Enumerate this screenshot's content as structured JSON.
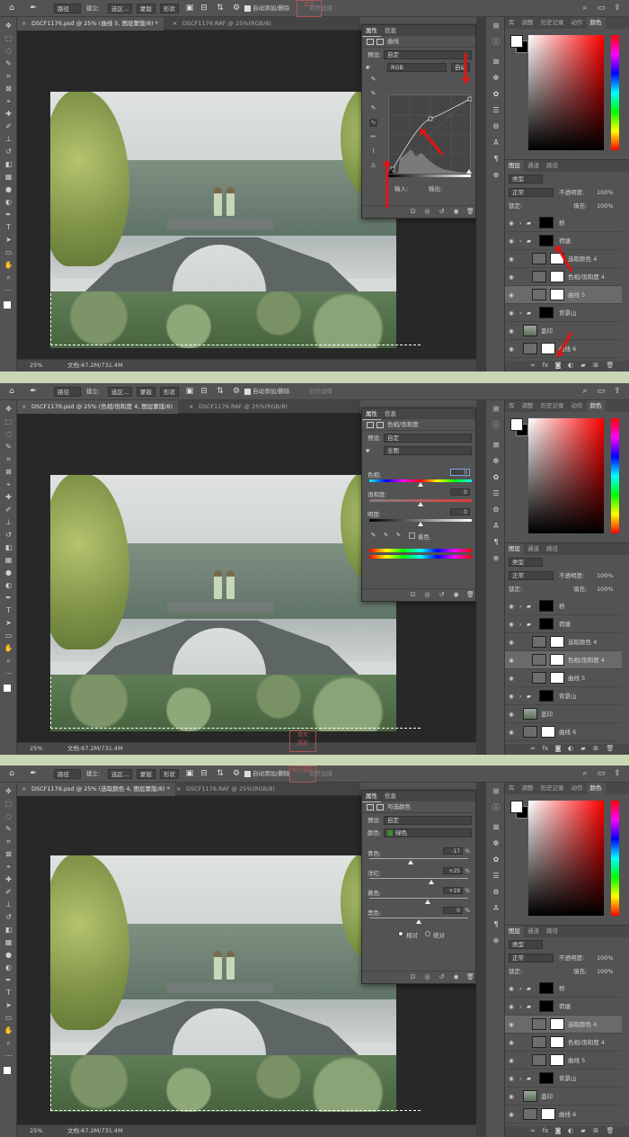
{
  "toolbar": {
    "path_label": "路径",
    "build_label": "建立:",
    "selection_btn": "选区...",
    "mask_btn": "蒙版",
    "shape_btn": "形状",
    "auto_add": "自动添加/删除",
    "align_edges": "对齐边缘"
  },
  "screens": [
    {
      "tab_active": "DSCF1176.psd @ 25% (曲线 5, 图层蒙版/8) *",
      "tab_other": "DSCF1176.RAF @ 25%(RGB/8)",
      "status": {
        "zoom": "25%",
        "doc": "文档:67.2M/731.4M"
      },
      "panel_tabs": [
        "属性",
        "信息"
      ],
      "panel_title": "曲线",
      "preset_label": "预设:",
      "preset_value": "自定",
      "channel_value": "RGB",
      "auto_btn": "自动",
      "input_label": "输入:",
      "output_label": "输出:",
      "selected_layer_index": 4
    },
    {
      "tab_active": "DSCF1176.psd @ 25% (色相/饱和度 4, 图层蒙版/8)",
      "tab_other": "DSCF1176.RAF @ 25%(RGB/8)",
      "status": {
        "zoom": "25%",
        "doc": "文档:67.2M/731.4M"
      },
      "panel_tabs": [
        "属性",
        "信息"
      ],
      "panel_title": "色相/饱和度",
      "preset_label": "预设:",
      "preset_value": "自定",
      "range_value": "全图",
      "hue_label": "色相:",
      "hue_value": "0",
      "sat_label": "饱和度:",
      "sat_value": "0",
      "light_label": "明度:",
      "light_value": "0",
      "colorize_label": "着色",
      "selected_layer_index": 3
    },
    {
      "tab_active": "DSCF1176.psd @ 25% (选取颜色 4, 图层蒙版/8) *",
      "tab_other": "DSCF1176.RAF @ 25%(RGB/8)",
      "status": {
        "zoom": "25%",
        "doc": "文档:67.2M/731.4M"
      },
      "panel_tabs": [
        "属性",
        "信息"
      ],
      "panel_title": "可选颜色",
      "preset_label": "预设:",
      "preset_value": "自定",
      "color_label": "颜色:",
      "color_value": "绿色",
      "sliders": [
        {
          "label": "青色:",
          "value": "-17",
          "unit": "%",
          "pos": 0.415
        },
        {
          "label": "洋红:",
          "value": "+25",
          "unit": "%",
          "pos": 0.625
        },
        {
          "label": "黄色:",
          "value": "+19",
          "unit": "%",
          "pos": 0.595
        },
        {
          "label": "黑色:",
          "value": "0",
          "unit": "%",
          "pos": 0.5
        }
      ],
      "mode_relative": "相对",
      "mode_absolute": "绝对",
      "selected_layer_index": 2
    }
  ],
  "color_panel": {
    "tabs": [
      "库",
      "调整",
      "历史记录",
      "动作",
      "颜色"
    ]
  },
  "layers_panel": {
    "tabs": [
      "图层",
      "通道",
      "路径"
    ],
    "kind": "类型",
    "blend": "正常",
    "opacity_label": "不透明度:",
    "opacity": "100%",
    "lock_label": "锁定:",
    "fill_label": "填充:",
    "fill": "100%",
    "layers": [
      {
        "name": "桥",
        "indent": 0,
        "type": "group"
      },
      {
        "name": "荷塘",
        "indent": 0,
        "type": "group"
      },
      {
        "name": "选取颜色 4",
        "indent": 1,
        "type": "adj"
      },
      {
        "name": "色相/饱和度 4",
        "indent": 1,
        "type": "adj"
      },
      {
        "name": "曲线 5",
        "indent": 1,
        "type": "adj"
      },
      {
        "name": "背景山",
        "indent": 0,
        "type": "group"
      },
      {
        "name": "盖印",
        "indent": 0,
        "type": "pixel"
      },
      {
        "name": "曲线 6",
        "indent": 0,
        "type": "adj"
      }
    ]
  },
  "watermark": {
    "line1": "清风",
    "line2": "摄影",
    "note": "科学摄影"
  }
}
